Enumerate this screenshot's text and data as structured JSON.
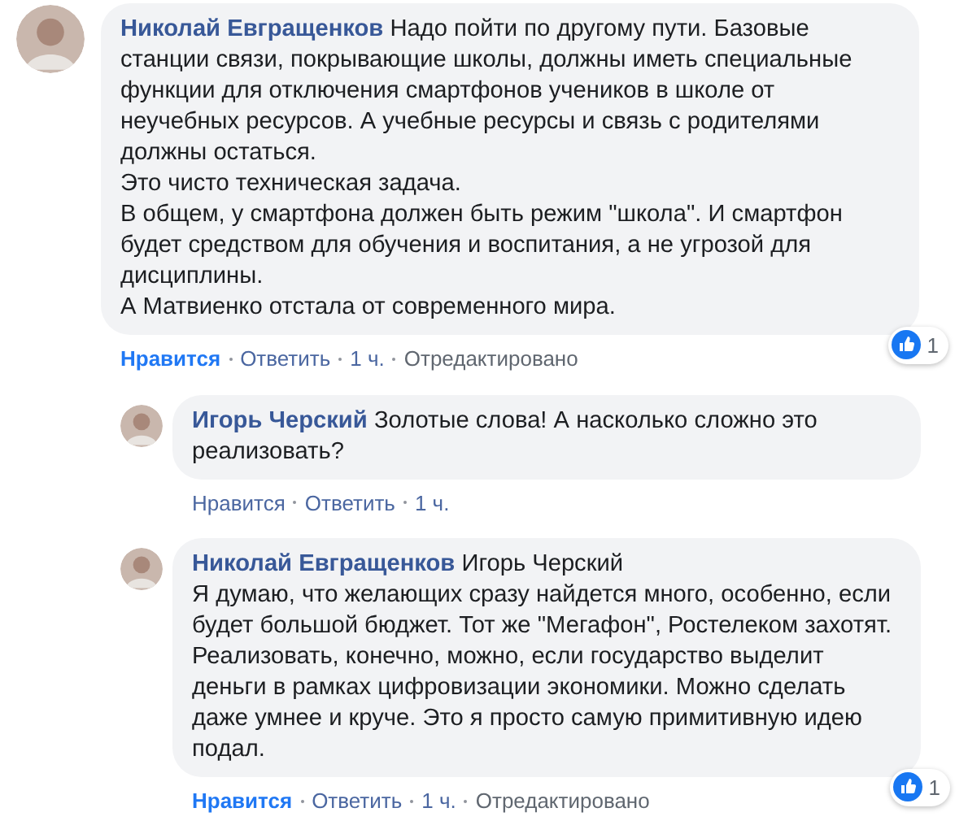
{
  "comments": [
    {
      "kind": "top",
      "author": "Николай Евгращенков",
      "text": "Надо пойти по другому пути. Базовые станции связи, покрывающие школы, должны иметь специальные функции для отключения смартфонов учеников в школе от неучебных ресурсов. А учебные ресурсы и связь с родителями должны остаться.\nЭто чисто техническая задача.\nВ общем, у смартфона должен быть режим \"школа\". И смартфон будет средством для обучения и воспитания, а не угрозой для дисциплины.\nА Матвиенко отстала от современного мира.",
      "like": {
        "label": "Нравится",
        "selected": true
      },
      "reply": "Ответить",
      "time": "1 ч.",
      "edited": "Отредактировано",
      "reactions": "1"
    },
    {
      "kind": "reply",
      "author": "Игорь Черский",
      "text": "Золотые слова! А насколько сложно это реализовать?",
      "like": {
        "label": "Нравится",
        "selected": false
      },
      "reply": "Ответить",
      "time": "1 ч."
    },
    {
      "kind": "reply",
      "author": "Николай Евгращенков",
      "mention": "Игорь Черский",
      "text": "Я думаю, что желающих сразу найдется много, особенно, если будет большой бюджет. Тот же \"Мегафон\", Ростелеком захотят. Реализовать, конечно, можно, если государство выделит деньги в рамках цифровизации экономики. Можно сделать даже умнее и круче. Это я просто самую примитивную идею подал.",
      "like": {
        "label": "Нравится",
        "selected": true
      },
      "reply": "Ответить",
      "time": "1 ч.",
      "edited": "Отредактировано",
      "reactions": "1"
    }
  ]
}
